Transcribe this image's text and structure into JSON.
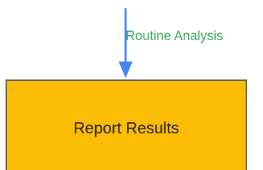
{
  "colors": {
    "arrow": "#4285f4",
    "edge_label": "#34a853",
    "node_fill": "#fbbc05",
    "node_stroke": "#5f5f5f",
    "node_text": "#202124"
  },
  "edge": {
    "label": "Routine Analysis"
  },
  "node": {
    "label": "Report Results"
  }
}
